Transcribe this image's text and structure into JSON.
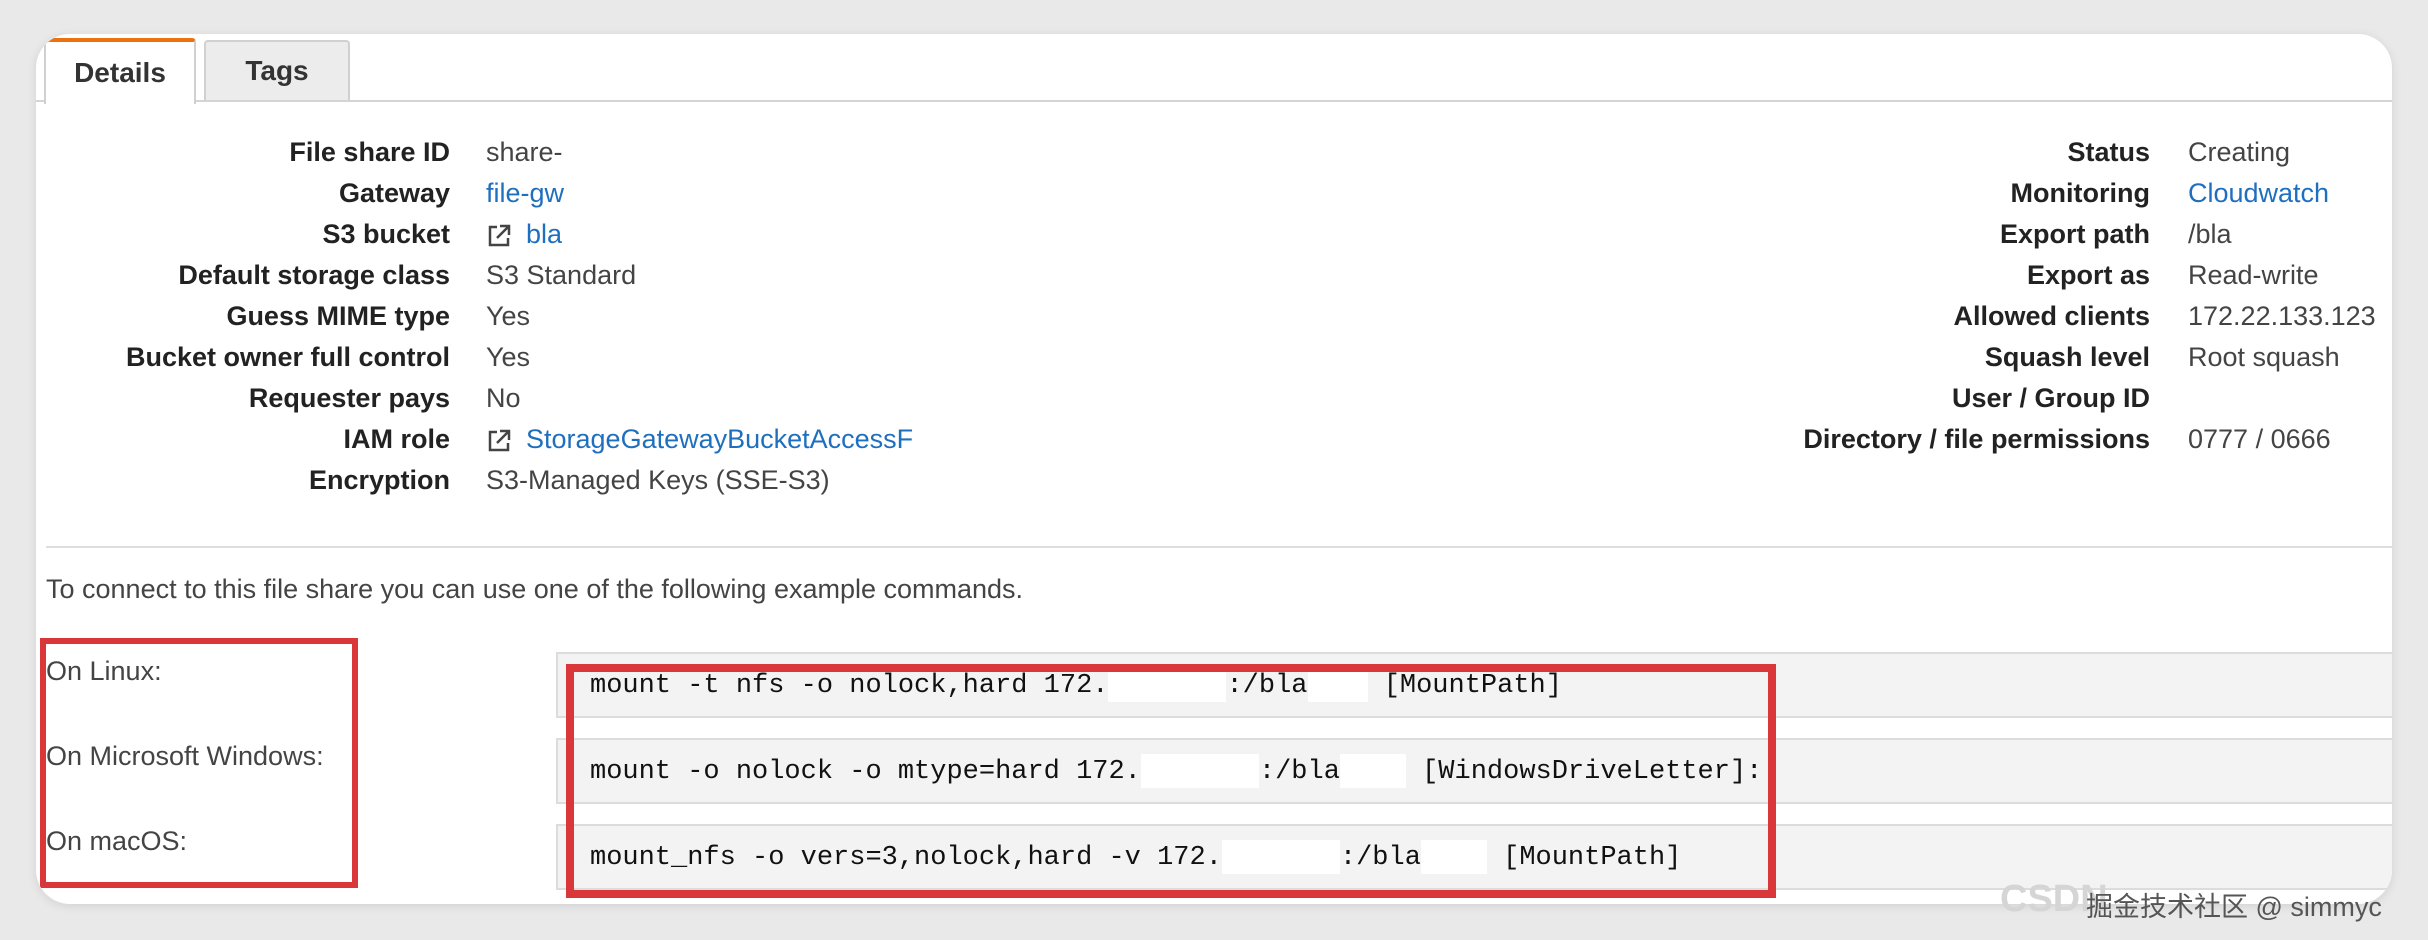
{
  "tabs": [
    {
      "label": "Details",
      "active": true
    },
    {
      "label": "Tags",
      "active": false
    }
  ],
  "left_fields": [
    {
      "label": "File share ID",
      "value": "share-",
      "type": "text"
    },
    {
      "label": "Gateway",
      "value": "file-gw",
      "type": "link"
    },
    {
      "label": "S3 bucket",
      "value": "bla",
      "type": "external-link"
    },
    {
      "label": "Default storage class",
      "value": "S3 Standard",
      "type": "text"
    },
    {
      "label": "Guess MIME type",
      "value": "Yes",
      "type": "text"
    },
    {
      "label": "Bucket owner full control",
      "value": "Yes",
      "type": "text"
    },
    {
      "label": "Requester pays",
      "value": "No",
      "type": "text"
    },
    {
      "label": "IAM role",
      "value": "StorageGatewayBucketAccessF",
      "type": "external-link"
    },
    {
      "label": "Encryption",
      "value": "S3-Managed Keys (SSE-S3)",
      "type": "text"
    }
  ],
  "right_fields": [
    {
      "label": "Status",
      "value": "Creating",
      "type": "text"
    },
    {
      "label": "Monitoring",
      "value": "Cloudwatch",
      "type": "link"
    },
    {
      "label": "Export path",
      "value": "/bla",
      "type": "text"
    },
    {
      "label": "Export as",
      "value": "Read-write",
      "type": "text"
    },
    {
      "label": "Allowed clients",
      "value": "172.22.133.123",
      "type": "text"
    },
    {
      "label": "Squash level",
      "value": "Root squash",
      "type": "text"
    },
    {
      "label": "User / Group ID",
      "value": "",
      "type": "text"
    },
    {
      "label": "Directory / file permissions",
      "value": "0777 / 0666",
      "type": "text"
    }
  ],
  "intro_text": "To connect to this file share you can use one of the following example commands.",
  "commands": [
    {
      "os": "On Linux:",
      "part1": "mount -t nfs -o nolock,hard 172.",
      "part2": ":/bla",
      "part3": "[MountPath]"
    },
    {
      "os": "On Microsoft Windows:",
      "part1": "mount -o nolock -o mtype=hard 172.",
      "part2": ":/bla",
      "part3": "[WindowsDriveLetter]:"
    },
    {
      "os": "On macOS:",
      "part1": "mount_nfs -o vers=3,nolock,hard -v 172.",
      "part2": ":/bla",
      "part3": "[MountPath]"
    }
  ],
  "watermark": {
    "faded": "CSDN",
    "text": "掘金技术社区 @ simmyc"
  },
  "colors": {
    "link": "#1f6fbf",
    "highlight": "#d9373a",
    "tab_accent": "#ec7211"
  }
}
